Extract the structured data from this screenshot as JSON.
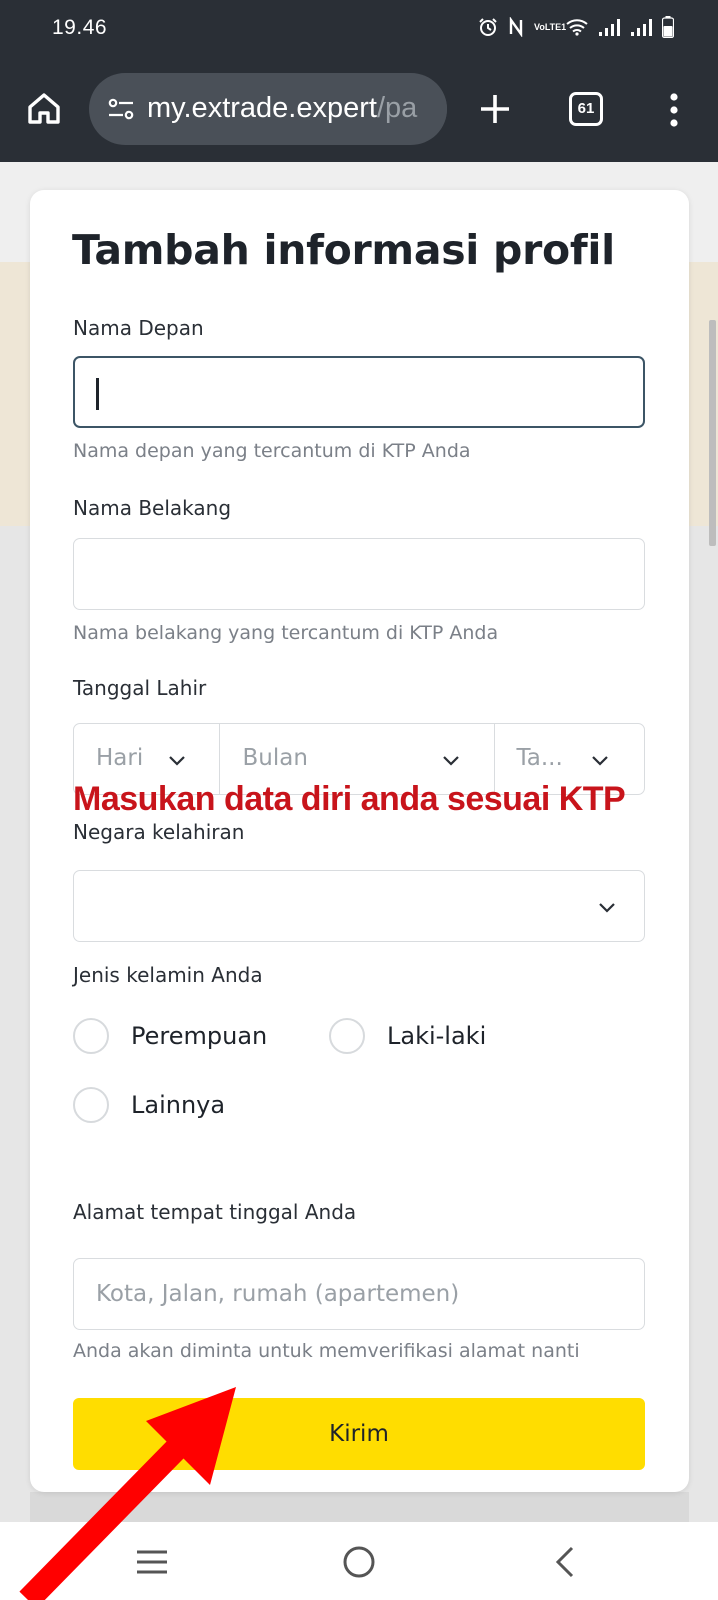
{
  "status_bar": {
    "time": "19.46",
    "icons": [
      "alarm-icon",
      "nfc-icon",
      "volte-icon",
      "wifi-icon",
      "signal-icon",
      "signal-icon",
      "battery-icon"
    ],
    "volte_label": "VoLTE1"
  },
  "browser": {
    "url_host": "my.extrade.expert",
    "url_path": "/pa",
    "tab_count": "61",
    "icons": [
      "home-icon",
      "tune-icon",
      "plus-icon",
      "tabs-icon",
      "more-vert-icon"
    ]
  },
  "form": {
    "title": "Tambah informasi profil",
    "first_name": {
      "label": "Nama Depan",
      "value": "",
      "hint": "Nama depan yang tercantum di KTP Anda"
    },
    "last_name": {
      "label": "Nama Belakang",
      "value": "",
      "hint": "Nama belakang yang tercantum di KTP Anda"
    },
    "birth_date": {
      "label": "Tanggal Lahir",
      "day_placeholder": "Hari",
      "month_placeholder": "Bulan",
      "year_placeholder": "Ta..."
    },
    "birth_country": {
      "label": "Negara kelahiran",
      "value": ""
    },
    "gender": {
      "label": "Jenis kelamin Anda",
      "options": [
        "Perempuan",
        "Laki-laki",
        "Lainnya"
      ],
      "selected": null
    },
    "address": {
      "label": "Alamat tempat tinggal Anda",
      "placeholder": "Kota, Jalan, rumah (apartemen)",
      "hint": "Anda akan diminta untuk memverifikasi alamat nanti"
    },
    "submit_label": "Kirim"
  },
  "annotation": {
    "text": "Masukan data diri anda sesuai KTP",
    "color": "#c8141b"
  },
  "colors": {
    "primary_button": "#ffdd00",
    "browser_chrome": "#2a2f36",
    "focus_border": "#3c5566"
  },
  "nav_bar": {
    "icons": [
      "recent-apps-icon",
      "home-circle-icon",
      "back-icon"
    ]
  }
}
